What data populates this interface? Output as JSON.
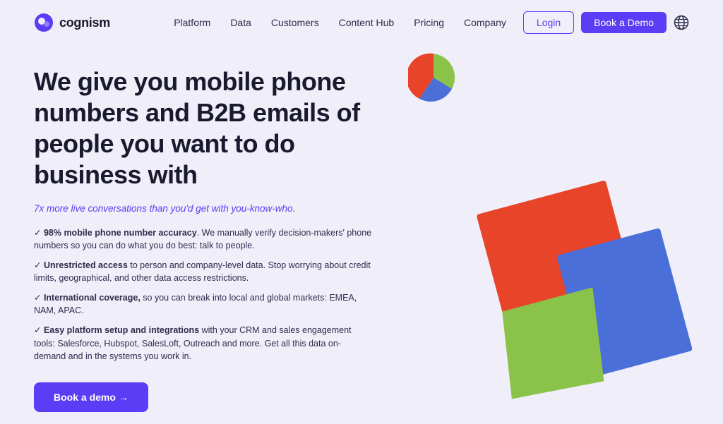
{
  "logo": {
    "text": "cognism"
  },
  "nav": {
    "links": [
      {
        "label": "Platform",
        "id": "platform"
      },
      {
        "label": "Data",
        "id": "data"
      },
      {
        "label": "Customers",
        "id": "customers"
      },
      {
        "label": "Content Hub",
        "id": "content-hub"
      },
      {
        "label": "Pricing",
        "id": "pricing"
      },
      {
        "label": "Company",
        "id": "company"
      }
    ],
    "login_label": "Login",
    "demo_label": "Book a Demo"
  },
  "hero": {
    "heading": "We give you mobile phone numbers and B2B emails of people you want to do business with",
    "tagline": "7x more live conversations than you'd get with ",
    "tagline_italic": "you-know-who.",
    "features": [
      {
        "bold": "98% mobile phone number accuracy",
        "text": ". We manually verify decision-makers' phone numbers so you can do what you do best: talk to people."
      },
      {
        "bold": "Unrestricted access",
        "text": " to person and company-level data. Stop worrying about credit limits, geographical, and other data access restrictions."
      },
      {
        "bold": "International coverage,",
        "text": " so you can break into local and global markets: EMEA, NAM, APAC."
      },
      {
        "bold": "Easy platform setup and integrations",
        "text": " with your CRM and sales engagement tools: Salesforce, Hubspot, SalesLoft, Outreach and more. Get all this data on-demand and in the systems you work in."
      }
    ],
    "cta_label": "Book a demo →"
  },
  "colors": {
    "purple": "#5b3df5",
    "red": "#e8442a",
    "green": "#8bc34a",
    "blue": "#4a6fd8",
    "bg": "#f0eef8"
  }
}
